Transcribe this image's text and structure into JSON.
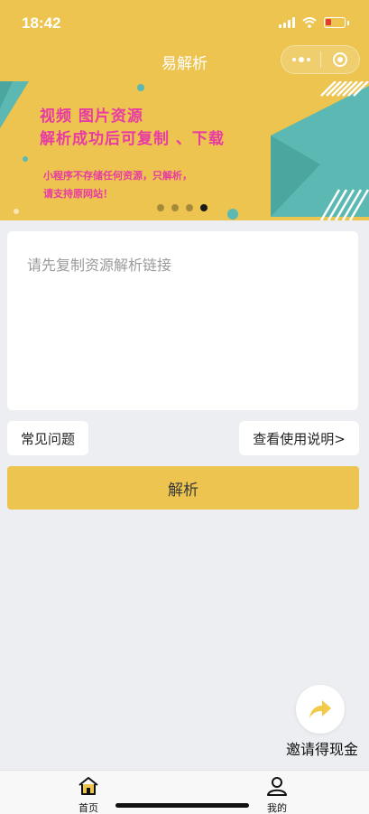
{
  "status_bar": {
    "time": "18:42"
  },
  "header": {
    "title": "易解析"
  },
  "banner": {
    "line1": "视频  图片资源",
    "line2": "解析成功后可复制 、下载",
    "note1": "小程序不存储任何资源，只解析，",
    "note2": "请支持原网站！",
    "page_count": 4,
    "active_index": 3
  },
  "input": {
    "placeholder": "请先复制资源解析链接",
    "value": ""
  },
  "buttons": {
    "faq": "常见问题",
    "guide": "查看使用说明>",
    "parse": "解析"
  },
  "invite": {
    "label": "邀请得现金"
  },
  "tabbar": {
    "items": [
      {
        "label": "首页",
        "icon": "home-icon",
        "active": true
      },
      {
        "label": "我的",
        "icon": "user-icon",
        "active": false
      }
    ]
  },
  "colors": {
    "brand_yellow": "#ecc44f",
    "banner_teal": "#5cb8b2",
    "banner_pink": "#e83ba4",
    "page_bg": "#eceef1"
  }
}
